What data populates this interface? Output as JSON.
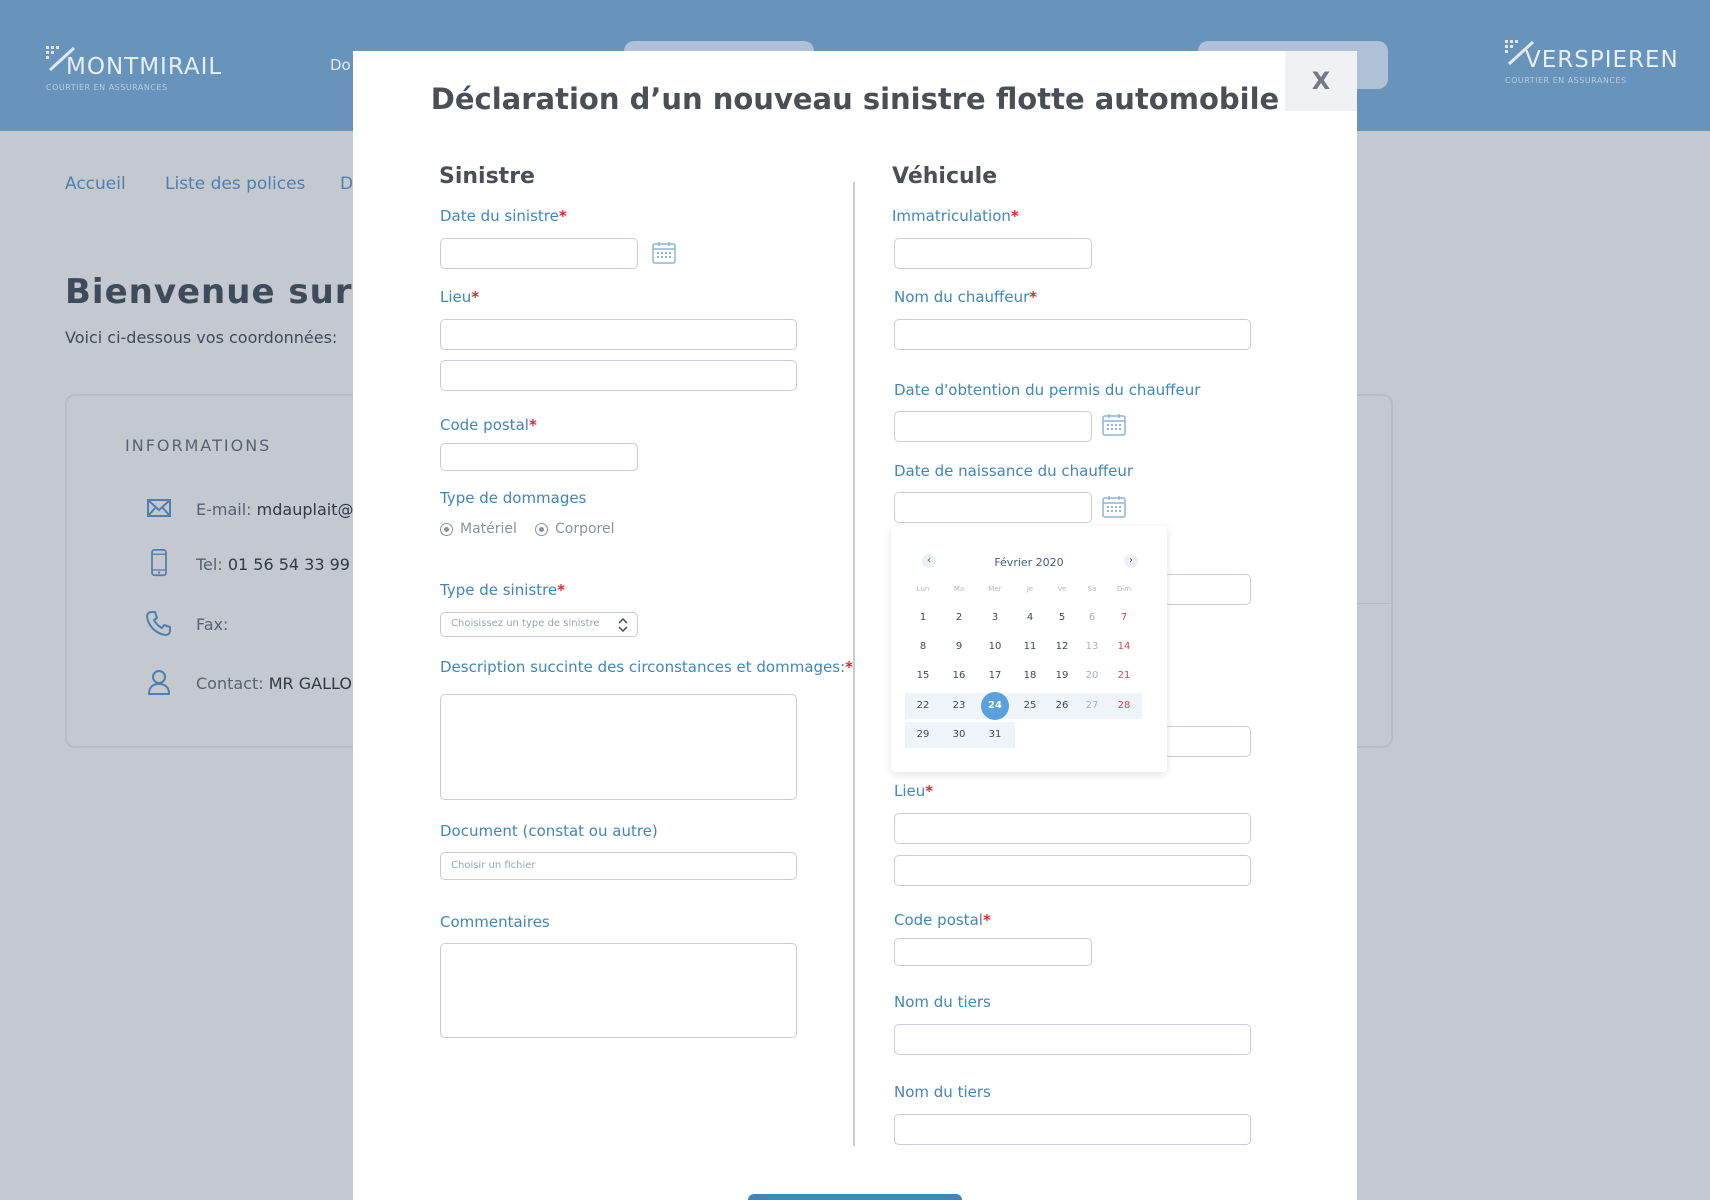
{
  "header": {
    "logo_left": {
      "name": "MONTMIRAIL",
      "sub": "COURTIER EN ASSURANCES"
    },
    "logo_right": {
      "name": "VERSPIEREN",
      "sub": "COURTIER EN ASSURANCES"
    },
    "nav_partial": "Do"
  },
  "background": {
    "tabs": [
      "Accueil",
      "Liste des polices",
      "D"
    ],
    "title": "Bienvenue sur vo",
    "subtitle": "Voici ci-dessous vos coordonnées:",
    "card_title": "INFORMATIONS",
    "info": {
      "email_label": "E-mail:",
      "email_value": "mdauplait@sa",
      "tel_label": "Tel:",
      "tel_value": "01 56 54 33 99",
      "fax_label": "Fax:",
      "contact_label": "Contact:",
      "contact_value": "MR GALLOIS"
    }
  },
  "modal": {
    "title": "Déclaration d’un nouveau sinistre flotte automobile",
    "close_label": "X",
    "required_mark": "*",
    "sinistre": {
      "title": "Sinistre",
      "date_label": "Date du sinistre",
      "lieu_label": "Lieu",
      "code_postal_label": "Code postal",
      "type_dommages_label": "Type de dommages",
      "dommages_options": [
        "Matériel",
        "Corporel"
      ],
      "type_sinistre_label": "Type de sinistre",
      "type_sinistre_placeholder": "Choisissez un type de sinistre",
      "description_label": "Description succinte des circonstances et dommages:",
      "document_label": "Document (constat ou autre)",
      "document_placeholder": "Choisir un fichier",
      "commentaires_label": "Commentaires"
    },
    "vehicule": {
      "title": "Véhicule",
      "immatriculation_label": "Immatriculation",
      "chauffeur_label": "Nom du chauffeur",
      "permis_label": "Date d'obtention du permis du chauffeur",
      "naissance_label": "Date de naissance du chauffeur",
      "lieu_label": "Lieu",
      "code_postal_label": "Code postal",
      "tiers_label_1": "Nom du tiers",
      "tiers_label_2": "Nom du tiers"
    }
  },
  "datepicker": {
    "month": "Février 2020",
    "prev": "‹",
    "next": "›",
    "weekdays": [
      "Lun",
      "Ma",
      "Mer",
      "Je",
      "Ve",
      "Sa",
      "Dim"
    ],
    "weeks": [
      [
        "1",
        "2",
        "3",
        "4",
        "5",
        "6",
        "7"
      ],
      [
        "8",
        "9",
        "10",
        "11",
        "12",
        "13",
        "14"
      ],
      [
        "15",
        "16",
        "17",
        "18",
        "19",
        "20",
        "21"
      ],
      [
        "22",
        "23",
        "24",
        "25",
        "26",
        "27",
        "28"
      ],
      [
        "29",
        "30",
        "31",
        "",
        "",
        "",
        ""
      ]
    ],
    "selected": "24",
    "colors": {
      "selected": "#5b9fdd",
      "sunday": "#d6474f",
      "label": "#3f86bd"
    }
  }
}
